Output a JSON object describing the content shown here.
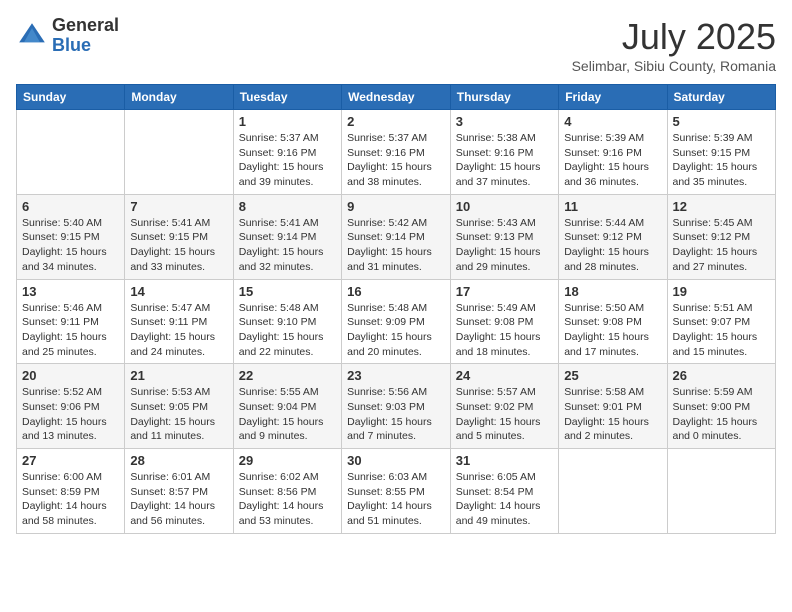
{
  "logo": {
    "general": "General",
    "blue": "Blue"
  },
  "header": {
    "month": "July 2025",
    "location": "Selimbar, Sibiu County, Romania"
  },
  "days_of_week": [
    "Sunday",
    "Monday",
    "Tuesday",
    "Wednesday",
    "Thursday",
    "Friday",
    "Saturday"
  ],
  "weeks": [
    [
      {
        "day": "",
        "sunrise": "",
        "sunset": "",
        "daylight": ""
      },
      {
        "day": "",
        "sunrise": "",
        "sunset": "",
        "daylight": ""
      },
      {
        "day": "1",
        "sunrise": "Sunrise: 5:37 AM",
        "sunset": "Sunset: 9:16 PM",
        "daylight": "Daylight: 15 hours and 39 minutes."
      },
      {
        "day": "2",
        "sunrise": "Sunrise: 5:37 AM",
        "sunset": "Sunset: 9:16 PM",
        "daylight": "Daylight: 15 hours and 38 minutes."
      },
      {
        "day": "3",
        "sunrise": "Sunrise: 5:38 AM",
        "sunset": "Sunset: 9:16 PM",
        "daylight": "Daylight: 15 hours and 37 minutes."
      },
      {
        "day": "4",
        "sunrise": "Sunrise: 5:39 AM",
        "sunset": "Sunset: 9:16 PM",
        "daylight": "Daylight: 15 hours and 36 minutes."
      },
      {
        "day": "5",
        "sunrise": "Sunrise: 5:39 AM",
        "sunset": "Sunset: 9:15 PM",
        "daylight": "Daylight: 15 hours and 35 minutes."
      }
    ],
    [
      {
        "day": "6",
        "sunrise": "Sunrise: 5:40 AM",
        "sunset": "Sunset: 9:15 PM",
        "daylight": "Daylight: 15 hours and 34 minutes."
      },
      {
        "day": "7",
        "sunrise": "Sunrise: 5:41 AM",
        "sunset": "Sunset: 9:15 PM",
        "daylight": "Daylight: 15 hours and 33 minutes."
      },
      {
        "day": "8",
        "sunrise": "Sunrise: 5:41 AM",
        "sunset": "Sunset: 9:14 PM",
        "daylight": "Daylight: 15 hours and 32 minutes."
      },
      {
        "day": "9",
        "sunrise": "Sunrise: 5:42 AM",
        "sunset": "Sunset: 9:14 PM",
        "daylight": "Daylight: 15 hours and 31 minutes."
      },
      {
        "day": "10",
        "sunrise": "Sunrise: 5:43 AM",
        "sunset": "Sunset: 9:13 PM",
        "daylight": "Daylight: 15 hours and 29 minutes."
      },
      {
        "day": "11",
        "sunrise": "Sunrise: 5:44 AM",
        "sunset": "Sunset: 9:12 PM",
        "daylight": "Daylight: 15 hours and 28 minutes."
      },
      {
        "day": "12",
        "sunrise": "Sunrise: 5:45 AM",
        "sunset": "Sunset: 9:12 PM",
        "daylight": "Daylight: 15 hours and 27 minutes."
      }
    ],
    [
      {
        "day": "13",
        "sunrise": "Sunrise: 5:46 AM",
        "sunset": "Sunset: 9:11 PM",
        "daylight": "Daylight: 15 hours and 25 minutes."
      },
      {
        "day": "14",
        "sunrise": "Sunrise: 5:47 AM",
        "sunset": "Sunset: 9:11 PM",
        "daylight": "Daylight: 15 hours and 24 minutes."
      },
      {
        "day": "15",
        "sunrise": "Sunrise: 5:48 AM",
        "sunset": "Sunset: 9:10 PM",
        "daylight": "Daylight: 15 hours and 22 minutes."
      },
      {
        "day": "16",
        "sunrise": "Sunrise: 5:48 AM",
        "sunset": "Sunset: 9:09 PM",
        "daylight": "Daylight: 15 hours and 20 minutes."
      },
      {
        "day": "17",
        "sunrise": "Sunrise: 5:49 AM",
        "sunset": "Sunset: 9:08 PM",
        "daylight": "Daylight: 15 hours and 18 minutes."
      },
      {
        "day": "18",
        "sunrise": "Sunrise: 5:50 AM",
        "sunset": "Sunset: 9:08 PM",
        "daylight": "Daylight: 15 hours and 17 minutes."
      },
      {
        "day": "19",
        "sunrise": "Sunrise: 5:51 AM",
        "sunset": "Sunset: 9:07 PM",
        "daylight": "Daylight: 15 hours and 15 minutes."
      }
    ],
    [
      {
        "day": "20",
        "sunrise": "Sunrise: 5:52 AM",
        "sunset": "Sunset: 9:06 PM",
        "daylight": "Daylight: 15 hours and 13 minutes."
      },
      {
        "day": "21",
        "sunrise": "Sunrise: 5:53 AM",
        "sunset": "Sunset: 9:05 PM",
        "daylight": "Daylight: 15 hours and 11 minutes."
      },
      {
        "day": "22",
        "sunrise": "Sunrise: 5:55 AM",
        "sunset": "Sunset: 9:04 PM",
        "daylight": "Daylight: 15 hours and 9 minutes."
      },
      {
        "day": "23",
        "sunrise": "Sunrise: 5:56 AM",
        "sunset": "Sunset: 9:03 PM",
        "daylight": "Daylight: 15 hours and 7 minutes."
      },
      {
        "day": "24",
        "sunrise": "Sunrise: 5:57 AM",
        "sunset": "Sunset: 9:02 PM",
        "daylight": "Daylight: 15 hours and 5 minutes."
      },
      {
        "day": "25",
        "sunrise": "Sunrise: 5:58 AM",
        "sunset": "Sunset: 9:01 PM",
        "daylight": "Daylight: 15 hours and 2 minutes."
      },
      {
        "day": "26",
        "sunrise": "Sunrise: 5:59 AM",
        "sunset": "Sunset: 9:00 PM",
        "daylight": "Daylight: 15 hours and 0 minutes."
      }
    ],
    [
      {
        "day": "27",
        "sunrise": "Sunrise: 6:00 AM",
        "sunset": "Sunset: 8:59 PM",
        "daylight": "Daylight: 14 hours and 58 minutes."
      },
      {
        "day": "28",
        "sunrise": "Sunrise: 6:01 AM",
        "sunset": "Sunset: 8:57 PM",
        "daylight": "Daylight: 14 hours and 56 minutes."
      },
      {
        "day": "29",
        "sunrise": "Sunrise: 6:02 AM",
        "sunset": "Sunset: 8:56 PM",
        "daylight": "Daylight: 14 hours and 53 minutes."
      },
      {
        "day": "30",
        "sunrise": "Sunrise: 6:03 AM",
        "sunset": "Sunset: 8:55 PM",
        "daylight": "Daylight: 14 hours and 51 minutes."
      },
      {
        "day": "31",
        "sunrise": "Sunrise: 6:05 AM",
        "sunset": "Sunset: 8:54 PM",
        "daylight": "Daylight: 14 hours and 49 minutes."
      },
      {
        "day": "",
        "sunrise": "",
        "sunset": "",
        "daylight": ""
      },
      {
        "day": "",
        "sunrise": "",
        "sunset": "",
        "daylight": ""
      }
    ]
  ]
}
